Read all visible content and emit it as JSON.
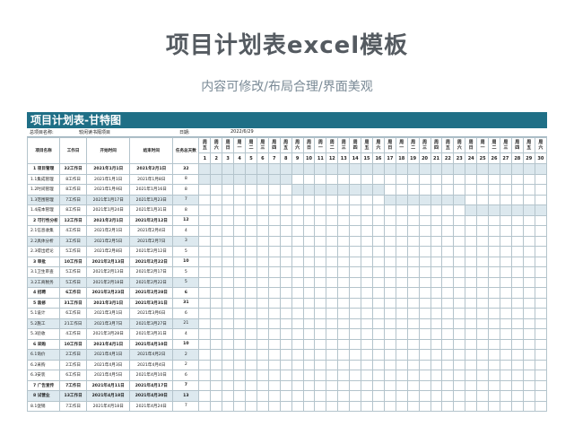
{
  "title": "项目计划表excel模板",
  "subtitle": "内容可修改/布局合理/界面美观",
  "sheet": {
    "title": "项目计划表-甘特图",
    "project_label": "总项目名称:",
    "project_name": "较闲读书隔项目",
    "date_label": "日期:",
    "date_value": "2022/6/29"
  },
  "headers": {
    "task": "项目名称",
    "duration": "工作日",
    "start": "开始时间",
    "end": "结束时间",
    "days": "任务总天数"
  },
  "weekdays": [
    "周五",
    "周六",
    "周日",
    "周一",
    "周二",
    "周三",
    "周四",
    "周五",
    "周六",
    "周日",
    "周一",
    "周二",
    "周三",
    "周四",
    "周五",
    "周六",
    "周日",
    "周一",
    "周二",
    "周三",
    "周四",
    "周五",
    "周六",
    "周日",
    "周一",
    "周二",
    "周三",
    "周四",
    "周五",
    "周六"
  ],
  "day_numbers": [
    "1",
    "2",
    "3",
    "4",
    "5",
    "6",
    "7",
    "8",
    "9",
    "10",
    "11",
    "12",
    "13",
    "14",
    "15",
    "16",
    "17",
    "18",
    "19",
    "20",
    "21",
    "22",
    "23",
    "24",
    "25",
    "26",
    "27",
    "28",
    "29",
    "30"
  ],
  "colors": {
    "header_bar": "#1f6f86",
    "highlight": "#dde9ef",
    "gantt_bar": "#dce8ee"
  },
  "tasks": [
    {
      "name": "1 项目管理",
      "duration": "32工作日",
      "start": "2021年1月1日",
      "end": "2021年2月1日",
      "days": "32",
      "bold": true,
      "hl": false,
      "bar": [
        1,
        30
      ]
    },
    {
      "name": "1.1集成管理",
      "duration": "8工作日",
      "start": "2021年1月1日",
      "end": "2021年1月8日",
      "days": "8",
      "bold": false,
      "hl": false,
      "bar": [
        1,
        8
      ]
    },
    {
      "name": "1.2时间管理",
      "duration": "8工作日",
      "start": "2021年1月9日",
      "end": "2021年1月16日",
      "days": "8",
      "bold": false,
      "hl": false,
      "bar": [
        9,
        16
      ]
    },
    {
      "name": "1.3范围管理",
      "duration": "7工作日",
      "start": "2021年1月17日",
      "end": "2021年1月23日",
      "days": "7",
      "bold": false,
      "hl": true,
      "bar": [
        17,
        23
      ]
    },
    {
      "name": "1.4成本管理",
      "duration": "8工作日",
      "start": "2021年1月24日",
      "end": "2021年1月31日",
      "days": "8",
      "bold": false,
      "hl": false,
      "bar": [
        24,
        30
      ]
    },
    {
      "name": "2 可行性分析",
      "duration": "12工作日",
      "start": "2021年2月1日",
      "end": "2021年2月12日",
      "days": "12",
      "bold": true,
      "hl": false,
      "bar": null
    },
    {
      "name": "2.1信息收集",
      "duration": "4工作日",
      "start": "2021年2月1日",
      "end": "2021年2月4日",
      "days": "4",
      "bold": false,
      "hl": false,
      "bar": null
    },
    {
      "name": "2.2具体分析",
      "duration": "3工作日",
      "start": "2021年2月5日",
      "end": "2021年2月7日",
      "days": "3",
      "bold": false,
      "hl": true,
      "bar": null
    },
    {
      "name": "2.3得出结论",
      "duration": "5工作日",
      "start": "2021年2月8日",
      "end": "2021年2月12日",
      "days": "5",
      "bold": false,
      "hl": false,
      "bar": null
    },
    {
      "name": "3 审批",
      "duration": "10工作日",
      "start": "2021年2月13日",
      "end": "2021年2月22日",
      "days": "10",
      "bold": true,
      "hl": false,
      "bar": null
    },
    {
      "name": "3.1卫生审查",
      "duration": "5工作日",
      "start": "2021年2月13日",
      "end": "2021年2月17日",
      "days": "5",
      "bold": false,
      "hl": false,
      "bar": null
    },
    {
      "name": "3.2工商税务",
      "duration": "5工作日",
      "start": "2021年2月18日",
      "end": "2021年2月22日",
      "days": "5",
      "bold": false,
      "hl": true,
      "bar": null
    },
    {
      "name": "4 招聘",
      "duration": "6工作日",
      "start": "2021年2月23日",
      "end": "2021年2月28日",
      "days": "6",
      "bold": true,
      "hl": false,
      "bar": null
    },
    {
      "name": "5 装修",
      "duration": "31工作日",
      "start": "2021年3月1日",
      "end": "2021年3月31日",
      "days": "31",
      "bold": true,
      "hl": false,
      "bar": null
    },
    {
      "name": "5.1设计",
      "duration": "6工作日",
      "start": "2021年3月1日",
      "end": "2021年3月6日",
      "days": "6",
      "bold": false,
      "hl": false,
      "bar": null
    },
    {
      "name": "5.2施工",
      "duration": "21工作日",
      "start": "2021年3月7日",
      "end": "2021年3月27日",
      "days": "21",
      "bold": false,
      "hl": true,
      "bar": null
    },
    {
      "name": "5.3验收",
      "duration": "4工作日",
      "start": "2021年3月28日",
      "end": "2021年3月31日",
      "days": "4",
      "bold": false,
      "hl": false,
      "bar": null
    },
    {
      "name": "6 采购",
      "duration": "10工作日",
      "start": "2021年4月1日",
      "end": "2021年4月10日",
      "days": "10",
      "bold": true,
      "hl": false,
      "bar": null
    },
    {
      "name": "6.1询价",
      "duration": "2工作日",
      "start": "2021年4月1日",
      "end": "2021年4月2日",
      "days": "2",
      "bold": false,
      "hl": true,
      "bar": null
    },
    {
      "name": "6.2采购",
      "duration": "2工作日",
      "start": "2021年4月3日",
      "end": "2021年4月4日",
      "days": "2",
      "bold": false,
      "hl": false,
      "bar": null
    },
    {
      "name": "6.3安装",
      "duration": "6工作日",
      "start": "2021年4月5日",
      "end": "2021年4月10日",
      "days": "6",
      "bold": false,
      "hl": false,
      "bar": null
    },
    {
      "name": "7 广告宣传",
      "duration": "7工作日",
      "start": "2021年4月11日",
      "end": "2021年4月17日",
      "days": "7",
      "bold": true,
      "hl": false,
      "bar": null
    },
    {
      "name": "8 试营业",
      "duration": "13工作日",
      "start": "2021年4月18日",
      "end": "2021年4月30日",
      "days": "13",
      "bold": true,
      "hl": true,
      "bar": null
    },
    {
      "name": "8.1促销",
      "duration": "7工作日",
      "start": "2021年4月18日",
      "end": "2021年4月24日",
      "days": "7",
      "bold": false,
      "hl": false,
      "bar": null
    }
  ]
}
